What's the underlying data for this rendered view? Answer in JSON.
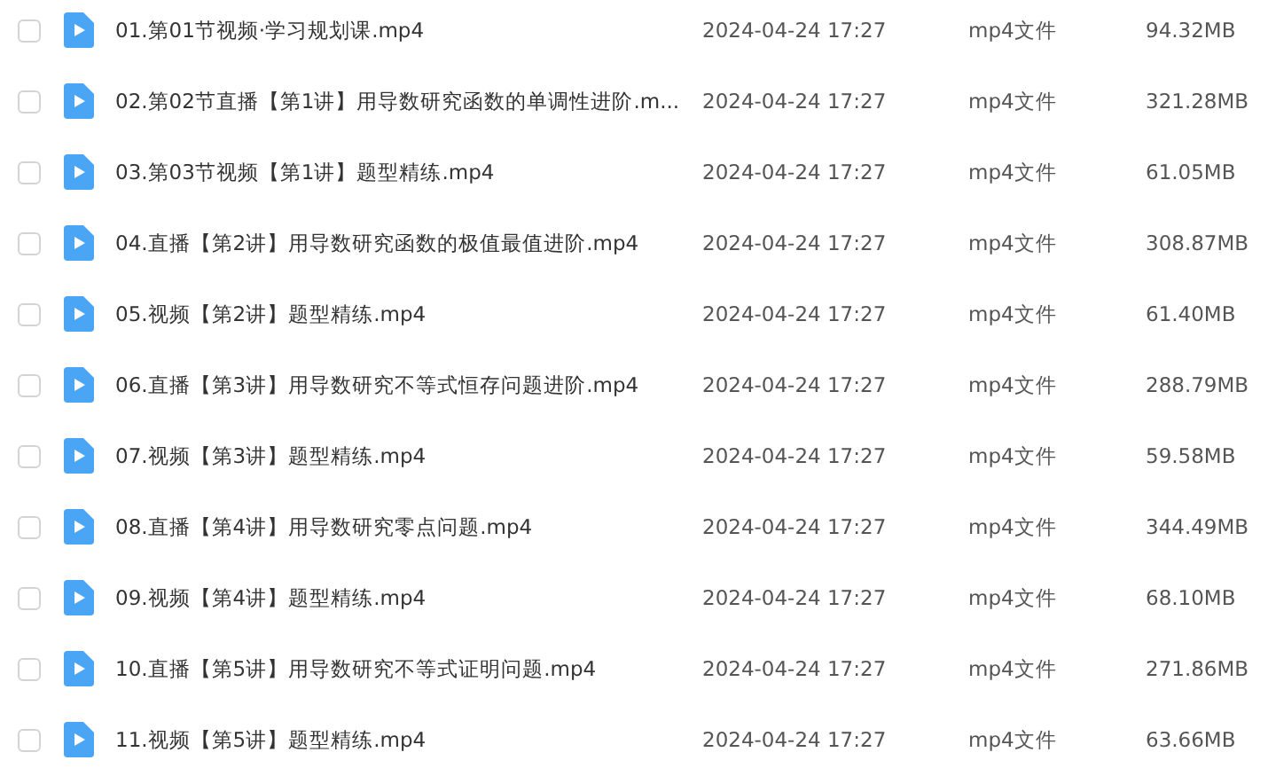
{
  "files": [
    {
      "name": "01.第01节视频·学习规划课.mp4",
      "modified": "2024-04-24 17:27",
      "type": "mp4文件",
      "size": "94.32MB",
      "checked": false
    },
    {
      "name": "02.第02节直播【第1讲】用导数研究函数的单调性进阶.m...",
      "modified": "2024-04-24 17:27",
      "type": "mp4文件",
      "size": "321.28MB",
      "checked": false
    },
    {
      "name": "03.第03节视频【第1讲】题型精练.mp4",
      "modified": "2024-04-24 17:27",
      "type": "mp4文件",
      "size": "61.05MB",
      "checked": false
    },
    {
      "name": "04.直播【第2讲】用导数研究函数的极值最值进阶.mp4",
      "modified": "2024-04-24 17:27",
      "type": "mp4文件",
      "size": "308.87MB",
      "checked": false
    },
    {
      "name": "05.视频【第2讲】题型精练.mp4",
      "modified": "2024-04-24 17:27",
      "type": "mp4文件",
      "size": "61.40MB",
      "checked": false
    },
    {
      "name": "06.直播【第3讲】用导数研究不等式恒存问题进阶.mp4",
      "modified": "2024-04-24 17:27",
      "type": "mp4文件",
      "size": "288.79MB",
      "checked": false
    },
    {
      "name": "07.视频【第3讲】题型精练.mp4",
      "modified": "2024-04-24 17:27",
      "type": "mp4文件",
      "size": "59.58MB",
      "checked": false
    },
    {
      "name": "08.直播【第4讲】用导数研究零点问题.mp4",
      "modified": "2024-04-24 17:27",
      "type": "mp4文件",
      "size": "344.49MB",
      "checked": false
    },
    {
      "name": "09.视频【第4讲】题型精练.mp4",
      "modified": "2024-04-24 17:27",
      "type": "mp4文件",
      "size": "68.10MB",
      "checked": false
    },
    {
      "name": "10.直播【第5讲】用导数研究不等式证明问题.mp4",
      "modified": "2024-04-24 17:27",
      "type": "mp4文件",
      "size": "271.86MB",
      "checked": false
    },
    {
      "name": "11.视频【第5讲】题型精练.mp4",
      "modified": "2024-04-24 17:27",
      "type": "mp4文件",
      "size": "63.66MB",
      "checked": false
    }
  ]
}
